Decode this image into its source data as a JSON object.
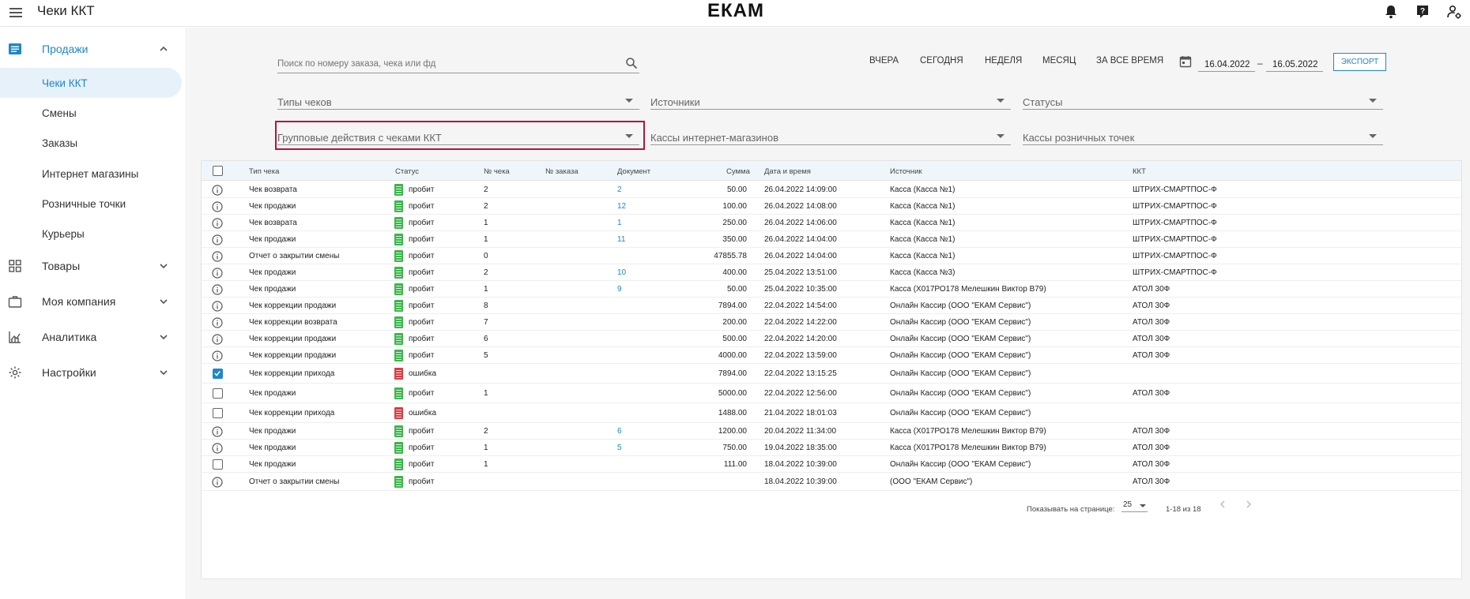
{
  "header": {
    "title": "Чеки ККТ",
    "logo": "ЕКАМ"
  },
  "sidebar": {
    "groups": [
      {
        "label": "Продажи",
        "icon": "receipt-list-icon",
        "expanded": true
      },
      {
        "label": "Товары",
        "icon": "grid-icon"
      },
      {
        "label": "Моя компания",
        "icon": "briefcase-icon"
      },
      {
        "label": "Аналитика",
        "icon": "chart-icon"
      },
      {
        "label": "Настройки",
        "icon": "gear-icon"
      }
    ],
    "sales_items": [
      "Чеки ККТ",
      "Смены",
      "Заказы",
      "Интернет магазины",
      "Розничные точки",
      "Курьеры"
    ]
  },
  "filters": {
    "search_placeholder": "Поиск по номеру заказа, чека или фд",
    "periods": [
      "ВЧЕРА",
      "СЕГОДНЯ",
      "НЕДЕЛЯ",
      "МЕСЯЦ",
      "ЗА ВСЕ ВРЕМЯ"
    ],
    "date_from": "16.04.2022",
    "date_separator": "–",
    "date_to": "16.05.2022",
    "export_label": "ЭКСПОРТ",
    "selects": [
      "Типы чеков",
      "Источники",
      "Статусы",
      "Групповые действия с чеками ККТ",
      "Кассы интернет-магазинов",
      "Кассы розничных точек"
    ]
  },
  "table": {
    "columns": [
      "Тип чека",
      "Статус",
      "№ чека",
      "№ заказа",
      "Документ",
      "Сумма",
      "Дата и время",
      "Источник",
      "ККТ"
    ],
    "rows": [
      {
        "lead": "info",
        "type": "Чек возврата",
        "status": "пробит",
        "st": "ok",
        "num": "2",
        "order": "",
        "doc": "2",
        "sum": "50.00",
        "date": "26.04.2022 14:09:00",
        "source": "Касса (Касса №1)",
        "kkt": "ШТРИХ-СМАРТПОС-Ф"
      },
      {
        "lead": "info",
        "type": "Чек продажи",
        "status": "пробит",
        "st": "ok",
        "num": "2",
        "order": "",
        "doc": "12",
        "sum": "100.00",
        "date": "26.04.2022 14:08:00",
        "source": "Касса (Касса №1)",
        "kkt": "ШТРИХ-СМАРТПОС-Ф"
      },
      {
        "lead": "info",
        "type": "Чек возврата",
        "status": "пробит",
        "st": "ok",
        "num": "1",
        "order": "",
        "doc": "1",
        "sum": "250.00",
        "date": "26.04.2022 14:06:00",
        "source": "Касса (Касса №1)",
        "kkt": "ШТРИХ-СМАРТПОС-Ф"
      },
      {
        "lead": "info",
        "type": "Чек продажи",
        "status": "пробит",
        "st": "ok",
        "num": "1",
        "order": "",
        "doc": "11",
        "sum": "350.00",
        "date": "26.04.2022 14:04:00",
        "source": "Касса (Касса №1)",
        "kkt": "ШТРИХ-СМАРТПОС-Ф"
      },
      {
        "lead": "info",
        "type": "Отчет о закрытии смены",
        "status": "пробит",
        "st": "ok",
        "num": "0",
        "order": "",
        "doc": "",
        "sum": "47855.78",
        "date": "26.04.2022 14:04:00",
        "source": "Касса (Касса №1)",
        "kkt": "ШТРИХ-СМАРТПОС-Ф"
      },
      {
        "lead": "info",
        "type": "Чек продажи",
        "status": "пробит",
        "st": "ok",
        "num": "2",
        "order": "",
        "doc": "10",
        "sum": "400.00",
        "date": "25.04.2022 13:51:00",
        "source": "Касса (Касса №3)",
        "kkt": "ШТРИХ-СМАРТПОС-Ф"
      },
      {
        "lead": "info",
        "type": "Чек продажи",
        "status": "пробит",
        "st": "ok",
        "num": "1",
        "order": "",
        "doc": "9",
        "sum": "50.00",
        "date": "25.04.2022 10:35:00",
        "source": "Касса (Х017РО178 Мелешкин Виктор В79)",
        "kkt": "АТОЛ 30Ф"
      },
      {
        "lead": "info",
        "type": "Чек коррекции продажи",
        "status": "пробит",
        "st": "ok",
        "num": "8",
        "order": "",
        "doc": "",
        "sum": "7894.00",
        "date": "22.04.2022 14:54:00",
        "source": "Онлайн Кассир (ООО \"ЕКАМ Сервис\")",
        "kkt": "АТОЛ 30Ф"
      },
      {
        "lead": "info",
        "type": "Чек коррекции возврата",
        "status": "пробит",
        "st": "ok",
        "num": "7",
        "order": "",
        "doc": "",
        "sum": "200.00",
        "date": "22.04.2022 14:22:00",
        "source": "Онлайн Кассир (ООО \"ЕКАМ Сервис\")",
        "kkt": "АТОЛ 30Ф"
      },
      {
        "lead": "info",
        "type": "Чек коррекции продажи",
        "status": "пробит",
        "st": "ok",
        "num": "6",
        "order": "",
        "doc": "",
        "sum": "500.00",
        "date": "22.04.2022 14:20:00",
        "source": "Онлайн Кассир (ООО \"ЕКАМ Сервис\")",
        "kkt": "АТОЛ 30Ф"
      },
      {
        "lead": "info",
        "type": "Чек коррекции продажи",
        "status": "пробит",
        "st": "ok",
        "num": "5",
        "order": "",
        "doc": "",
        "sum": "4000.00",
        "date": "22.04.2022 13:59:00",
        "source": "Онлайн Кассир (ООО \"ЕКАМ Сервис\")",
        "kkt": "АТОЛ 30Ф"
      },
      {
        "lead": "checked",
        "type": "Чек коррекции прихода",
        "status": "ошибка",
        "st": "err",
        "num": "",
        "order": "",
        "doc": "",
        "sum": "7894.00",
        "date": "22.04.2022 13:15:25",
        "source": "Онлайн Кассир (ООО \"ЕКАМ Сервис\")",
        "kkt": ""
      },
      {
        "lead": "box",
        "type": "Чек продажи",
        "status": "пробит",
        "st": "ok",
        "num": "1",
        "order": "",
        "doc": "",
        "sum": "5000.00",
        "date": "22.04.2022 12:56:00",
        "source": "Онлайн Кассир (ООО \"ЕКАМ Сервис\")",
        "kkt": "АТОЛ 30Ф"
      },
      {
        "lead": "box",
        "type": "Чек коррекции прихода",
        "status": "ошибка",
        "st": "err",
        "num": "",
        "order": "",
        "doc": "",
        "sum": "1488.00",
        "date": "21.04.2022 18:01:03",
        "source": "Онлайн Кассир (ООО \"ЕКАМ Сервис\")",
        "kkt": ""
      },
      {
        "lead": "info",
        "type": "Чек продажи",
        "status": "пробит",
        "st": "ok",
        "num": "2",
        "order": "",
        "doc": "6",
        "sum": "1200.00",
        "date": "20.04.2022 11:34:00",
        "source": "Касса (Х017РО178 Мелешкин Виктор В79)",
        "kkt": "АТОЛ 30Ф"
      },
      {
        "lead": "info",
        "type": "Чек продажи",
        "status": "пробит",
        "st": "ok",
        "num": "1",
        "order": "",
        "doc": "5",
        "sum": "750.00",
        "date": "19.04.2022 18:35:00",
        "source": "Касса (Х017РО178 Мелешкин Виктор В79)",
        "kkt": "АТОЛ 30Ф"
      },
      {
        "lead": "box",
        "type": "Чек продажи",
        "status": "пробит",
        "st": "ok",
        "num": "1",
        "order": "",
        "doc": "",
        "sum": "111.00",
        "date": "18.04.2022 10:39:00",
        "source": "Онлайн Кассир (ООО \"ЕКАМ Сервис\")",
        "kkt": "АТОЛ 30Ф"
      },
      {
        "lead": "info",
        "type": "Отчет о закрытии смены",
        "status": "пробит",
        "st": "ok",
        "num": "",
        "order": "",
        "doc": "",
        "sum": "",
        "date": "18.04.2022 10:39:00",
        "source": "(ООО \"ЕКАМ Сервис\")",
        "kkt": "АТОЛ 30Ф"
      }
    ]
  },
  "pagination": {
    "per_page_label": "Показывать на странице:",
    "per_page_value": "25",
    "range": "1-18 из 18"
  },
  "colors": {
    "accent": "#1e88c8",
    "success": "#3cb64a",
    "error": "#e0393e",
    "highlight": "#b3143d"
  }
}
